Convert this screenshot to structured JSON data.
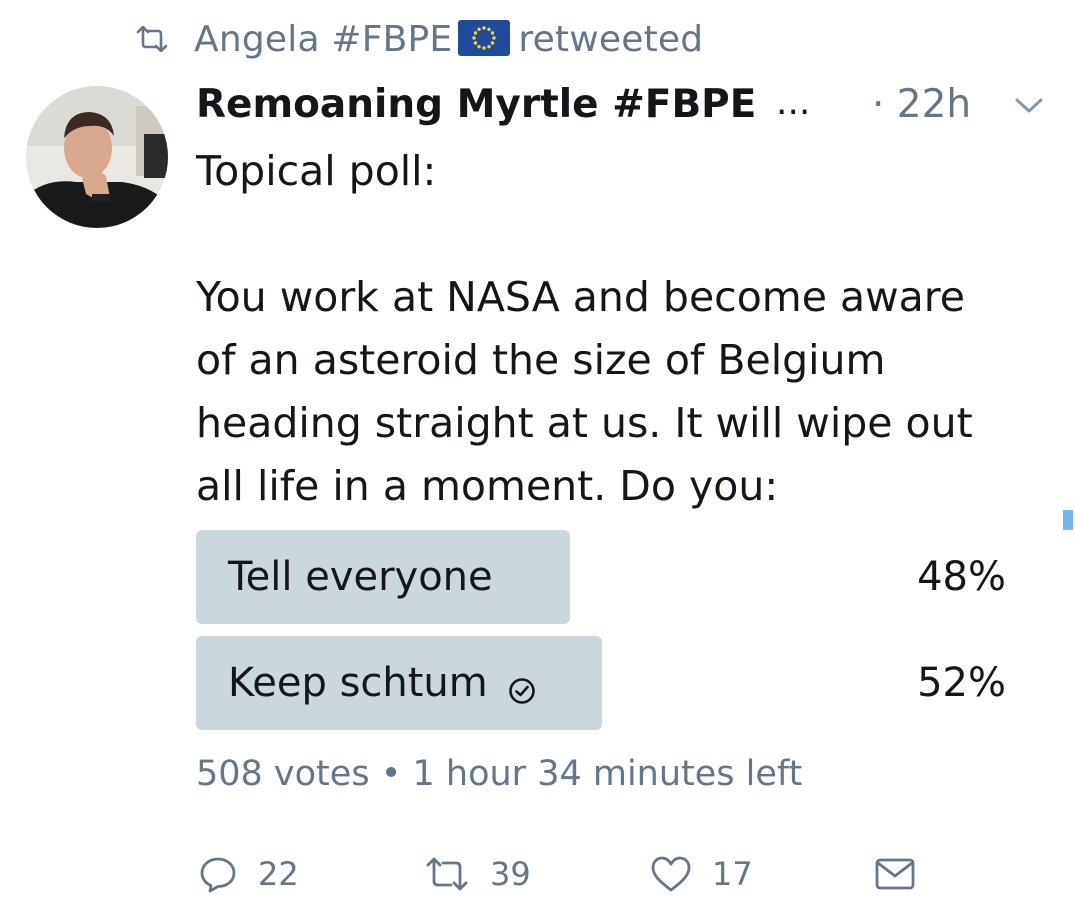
{
  "retweet_header": {
    "icon": "retweet-icon",
    "retweeter": "Angela #FBPE",
    "flag_icon": "eu-flag-icon",
    "suffix": "retweeted"
  },
  "tweet": {
    "author_name": "Remoaning Myrtle #FBPE",
    "name_ellipsis": "...",
    "time": "· 22h",
    "menu_icon": "chevron-down-icon",
    "text": "Topical poll:\n\nYou work at NASA and become aware\nof an asteroid the size of Belgium\nheading straight at us. It will wipe out\nall life in a moment. Do you:"
  },
  "poll": {
    "options": [
      {
        "label": "Tell everyone",
        "percent_text": "48%",
        "percent": 48
      },
      {
        "label": "Keep schtum",
        "percent_text": "52%",
        "percent": 52,
        "selected": true
      }
    ],
    "votes": "508 votes",
    "separator": "•",
    "time_left": "1 hour 34 minutes left"
  },
  "actions": {
    "reply_count": "22",
    "retweet_count": "39",
    "like_count": "17"
  },
  "colors": {
    "text": "#14171a",
    "secondary": "#657786",
    "poll_bar": "#ccd6dd",
    "accent": "#1da1f2"
  }
}
